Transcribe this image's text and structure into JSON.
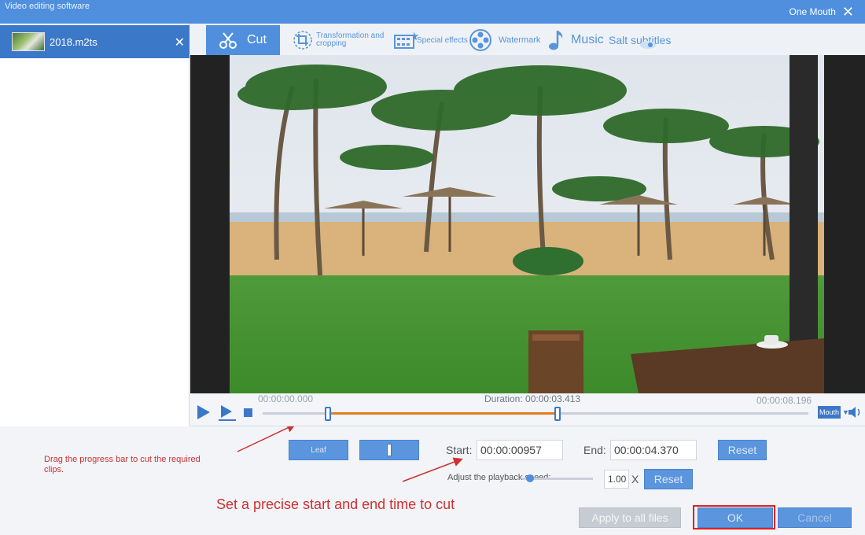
{
  "window": {
    "app_title": "Video editing software",
    "profile_label": "One Mouth",
    "close_glyph": "✕"
  },
  "sidebar": {
    "files": [
      {
        "name": "2018.m2ts",
        "thumb_icon": "video-thumbnail-icon",
        "close_glyph": "✕"
      }
    ]
  },
  "tabs": [
    {
      "label": "Cut",
      "icon": "scissors-icon",
      "active": true
    },
    {
      "label": "Transformation and cropping",
      "icon": "crop-icon",
      "active": false
    },
    {
      "label": "Special effects",
      "icon": "film-effects-icon",
      "active": false
    },
    {
      "label": "Watermark",
      "icon": "watermark-reel-icon",
      "active": false
    },
    {
      "label": "Music",
      "icon": "music-note-icon",
      "active": false
    },
    {
      "label": "Salt subtitles",
      "icon": "subtitles-icon",
      "active": false
    }
  ],
  "player": {
    "current_time": "00:00:00.000",
    "duration": "Duration: 00:00:03.413",
    "total_time": "00:00:08.196",
    "volume_label": "Mouth",
    "selection_start_fraction": 0.12,
    "selection_end_fraction": 0.54
  },
  "cut_panel": {
    "left_button": "Leaf",
    "start_label": "Start:",
    "start_value": "00:00:00957",
    "end_label": "End:",
    "end_value": "00:00:04.370",
    "reset_label": "Reset",
    "speed_label": "Adjust the playback speed:",
    "speed_value": "1.00",
    "speed_unit": "X",
    "speed_fraction": 0.05,
    "speed_reset_label": "Reset",
    "apply_all_label": "Apply to all files",
    "ok_label": "OK",
    "cancel_label": "Cancel"
  },
  "annotations": {
    "drag_hint": "Drag the progress bar to cut the required clips.",
    "precise_hint": "Set a precise start and end time to cut",
    "highlight_color": "#e02020"
  },
  "colors": {
    "accent": "#4f8fde",
    "selection": "#e37d20",
    "annotation": "#cf3030"
  }
}
